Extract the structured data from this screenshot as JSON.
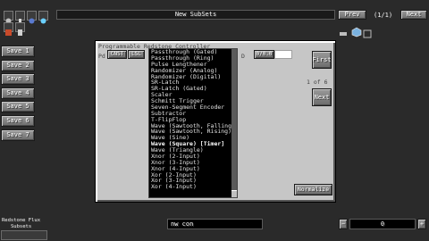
{
  "toolbar": {
    "title": "New SubSets",
    "prev_label": "Prev",
    "page_indicator": "(1/1)",
    "next_label": "Next",
    "icons": [
      "compass-icon",
      "potion-icon",
      "moon-icon",
      "clock-icon",
      "crafting-icon",
      "gear-icon",
      "block-icon",
      "book-icon"
    ]
  },
  "sidebar": {
    "items": [
      {
        "label": "Save 1"
      },
      {
        "label": "Save 2"
      },
      {
        "label": "Save 3"
      },
      {
        "label": "Save 4"
      },
      {
        "label": "Save 5"
      },
      {
        "label": "Save 6"
      },
      {
        "label": "Save 7"
      }
    ]
  },
  "dialog": {
    "title": "Programmable Redstone Controller",
    "left_label": "Pd",
    "btn_cnst": "CNST",
    "btn_lsl": "LSL",
    "right_label": "D",
    "right_value": "0/0.0",
    "first_label": "First",
    "page_text": "1 of 6",
    "next_label": "Next",
    "normalize_label": "Normalize",
    "list": [
      "Passthrough (Gated)",
      "Passthrough (Ring)",
      "Pulse Lengthener",
      "Randomizer (Analog)",
      "Randomizer (Digital)",
      "SR-Latch",
      "SR-Latch (Gated)",
      "Scaler",
      "Schmitt Trigger",
      "Seven-Segment Encoder",
      "Subtractor",
      "T-FlipFlop",
      "Wave (Sawtooth, Falling)",
      "Wave (Sawtooth, Rising)",
      "Wave (Sine)",
      "Wave (Square) [Timer]",
      "Wave (Triangle)",
      "Xnor (2-Input)",
      "Xnor (3-Input)",
      "Xnor (4-Input)",
      "Xor (2-Input)",
      "Xor (3-Input)",
      "Xor (4-Input)"
    ],
    "selected_index": 15
  },
  "bottom": {
    "search_value": "nw con",
    "right_value": "0"
  },
  "corner": {
    "line1": "Redstone Flux",
    "line2": "Subsets"
  },
  "colors": {
    "dialog_bg": "#c6c6c6",
    "button": "#8b8b8b",
    "list_bg": "#000000",
    "background": "#2a2a2a"
  }
}
